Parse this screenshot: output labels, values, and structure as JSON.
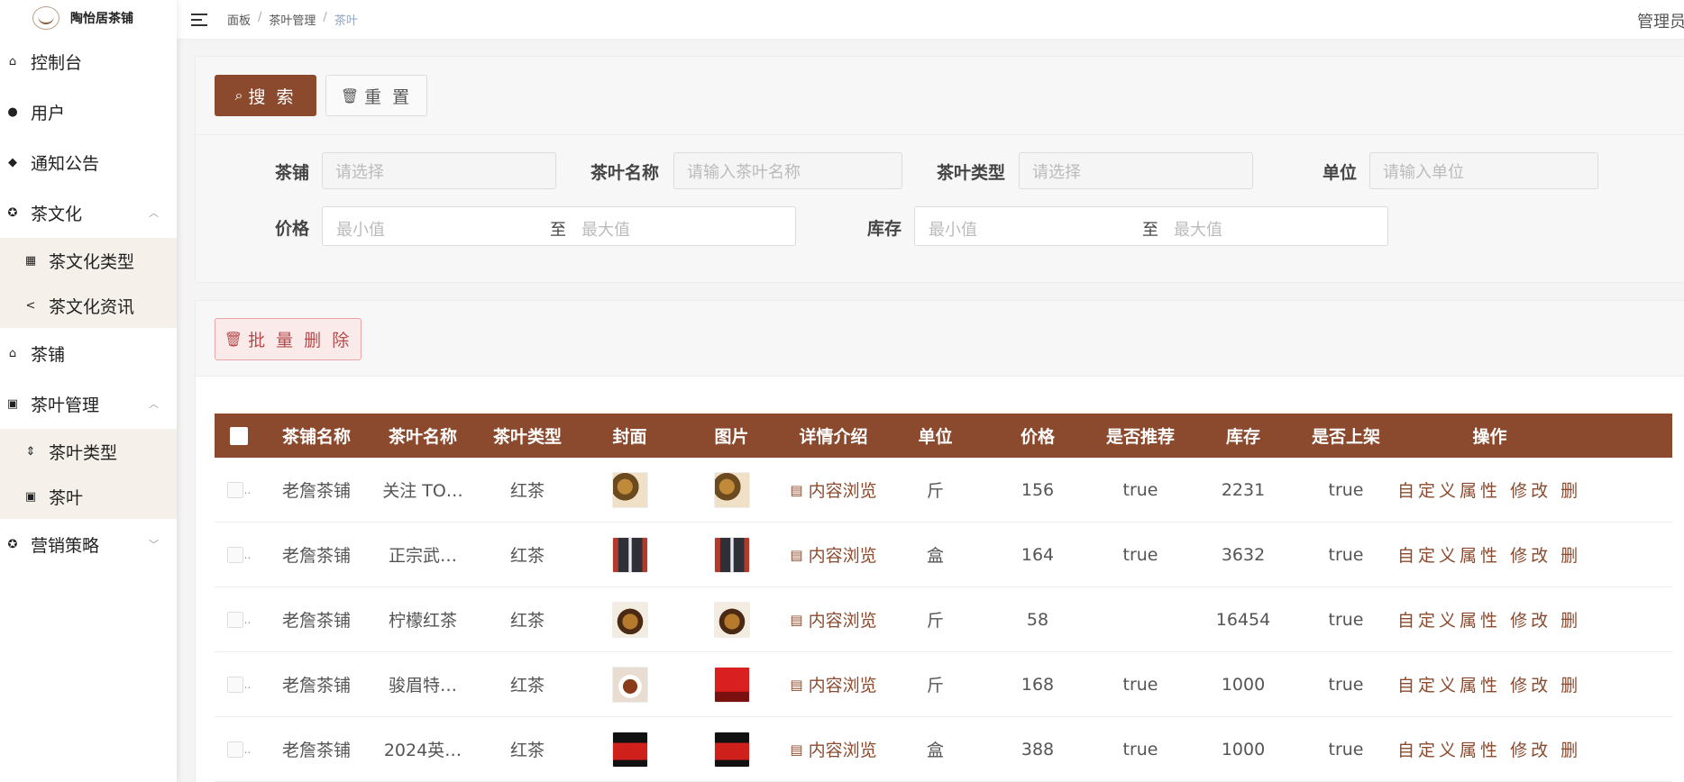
{
  "app": {
    "logo_text": "陶怡居茶铺"
  },
  "sidebar": {
    "items": [
      {
        "label": "控制台",
        "icon": "home-icon"
      },
      {
        "label": "用户",
        "icon": "user-icon"
      },
      {
        "label": "通知公告",
        "icon": "bell-icon"
      },
      {
        "label": "茶文化",
        "icon": "compass-icon",
        "expanded": true,
        "children": [
          {
            "label": "茶文化类型",
            "icon": "grid-icon"
          },
          {
            "label": "茶文化资讯",
            "icon": "share-icon"
          }
        ]
      },
      {
        "label": "茶铺",
        "icon": "house-outline-icon"
      },
      {
        "label": "茶叶管理",
        "icon": "bag-icon",
        "expanded": true,
        "children": [
          {
            "label": "茶叶类型",
            "icon": "sort-icon"
          },
          {
            "label": "茶叶",
            "icon": "bag-icon"
          }
        ]
      },
      {
        "label": "营销策略",
        "icon": "compass-icon",
        "expanded": false
      }
    ]
  },
  "breadcrumb": [
    "面板",
    "茶叶管理",
    "茶叶"
  ],
  "header": {
    "user_label": "管理员"
  },
  "search": {
    "search_label": "搜 索",
    "reset_label": "重 置",
    "fields": {
      "shop": {
        "label": "茶铺",
        "placeholder": "请选择"
      },
      "name": {
        "label": "茶叶名称",
        "placeholder": "请输入茶叶名称"
      },
      "type": {
        "label": "茶叶类型",
        "placeholder": "请选择"
      },
      "unit": {
        "label": "单位",
        "placeholder": "请输入单位"
      },
      "price": {
        "label": "价格",
        "min": "最小值",
        "to": "至",
        "max": "最大值"
      },
      "stock": {
        "label": "库存",
        "min": "最小值",
        "to": "至",
        "max": "最大值"
      }
    }
  },
  "table": {
    "batch_delete_label": "批 量 删 除",
    "columns": [
      "茶铺名称",
      "茶叶名称",
      "茶叶类型",
      "封面",
      "图片",
      "详情介绍",
      "单位",
      "价格",
      "是否推荐",
      "库存",
      "是否上架",
      "操作"
    ],
    "detail_label": "内容浏览",
    "ops": {
      "custom": "自定义属性",
      "edit": "修改",
      "delete": "删除"
    },
    "rows": [
      {
        "shop": "老詹茶铺",
        "name": "关注 TO…",
        "type": "红茶",
        "unit": "斤",
        "price": "156",
        "recommend": "true",
        "stock": "2231",
        "on_sale": "true"
      },
      {
        "shop": "老詹茶铺",
        "name": "正宗武…",
        "type": "红茶",
        "unit": "盒",
        "price": "164",
        "recommend": "true",
        "stock": "3632",
        "on_sale": "true"
      },
      {
        "shop": "老詹茶铺",
        "name": "柠檬红茶",
        "type": "红茶",
        "unit": "斤",
        "price": "58",
        "recommend": "",
        "stock": "16454",
        "on_sale": "true"
      },
      {
        "shop": "老詹茶铺",
        "name": "骏眉特…",
        "type": "红茶",
        "unit": "斤",
        "price": "168",
        "recommend": "true",
        "stock": "1000",
        "on_sale": "true"
      },
      {
        "shop": "老詹茶铺",
        "name": "2024英…",
        "type": "红茶",
        "unit": "盒",
        "price": "388",
        "recommend": "true",
        "stock": "1000",
        "on_sale": "true"
      }
    ]
  },
  "colors": {
    "primary": "#8b4a2e",
    "breadcrumb_active": "#8ea6c8",
    "danger_bg": "#fbeaea"
  }
}
